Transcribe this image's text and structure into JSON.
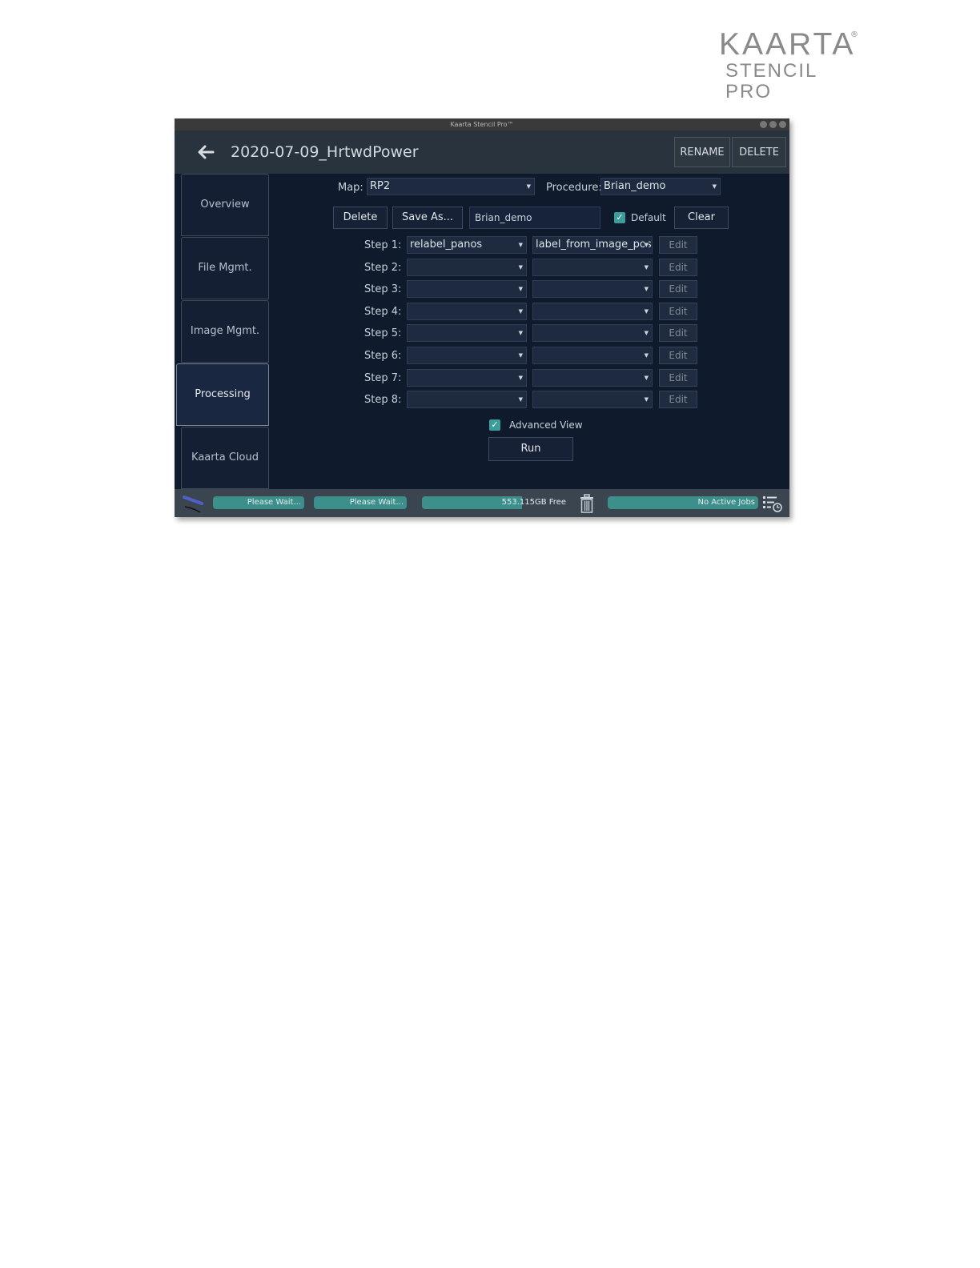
{
  "brand": {
    "line1": "KAARTA",
    "reg": "®",
    "line2": "STENCIL PRO"
  },
  "window": {
    "title": "Kaarta Stencil Pro™"
  },
  "header": {
    "title": "2020-07-09_HrtwdPower",
    "rename_label": "RENAME",
    "delete_label": "DELETE"
  },
  "sidebar": {
    "items": [
      {
        "label": "Overview"
      },
      {
        "label": "File Mgmt."
      },
      {
        "label": "Image Mgmt."
      },
      {
        "label": "Processing",
        "active": true
      },
      {
        "label": "Kaarta Cloud"
      }
    ]
  },
  "processing": {
    "map_label": "Map:",
    "map_value": "RP2",
    "procedure_label": "Procedure:",
    "procedure_value": "Brian_demo",
    "delete_label": "Delete",
    "save_as_label": "Save As...",
    "name_value": "Brian_demo",
    "default_label": "Default",
    "default_checked": true,
    "clear_label": "Clear",
    "steps": [
      {
        "label": "Step 1:",
        "first": "relabel_panos",
        "second": "label_from_image_pose",
        "edit": "Edit"
      },
      {
        "label": "Step 2:",
        "first": "",
        "second": "",
        "edit": "Edit"
      },
      {
        "label": "Step 3:",
        "first": "",
        "second": "",
        "edit": "Edit"
      },
      {
        "label": "Step 4:",
        "first": "",
        "second": "",
        "edit": "Edit"
      },
      {
        "label": "Step 5:",
        "first": "",
        "second": "",
        "edit": "Edit"
      },
      {
        "label": "Step 6:",
        "first": "",
        "second": "",
        "edit": "Edit"
      },
      {
        "label": "Step 7:",
        "first": "",
        "second": "",
        "edit": "Edit"
      },
      {
        "label": "Step 8:",
        "first": "",
        "second": "",
        "edit": "Edit"
      }
    ],
    "advanced_view_label": "Advanced View",
    "advanced_view_checked": true,
    "run_label": "Run"
  },
  "status": {
    "progress1": "Please Wait...",
    "progress2": "Please Wait...",
    "disk": "553.115GB Free",
    "jobs": "No Active Jobs"
  },
  "colors": {
    "accent": "#3b9e9a",
    "background": "#0f1a2c",
    "header": "#29333e"
  }
}
